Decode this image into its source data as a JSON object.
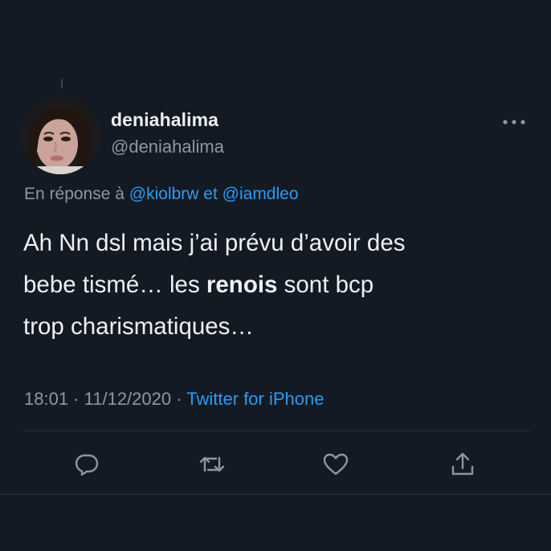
{
  "tweet": {
    "author": {
      "display_name": "deniahalima",
      "handle": "@deniahalima"
    },
    "reply_prefix": "En réponse à",
    "reply_mentions": [
      "@kiolbrw",
      "@iamdleo"
    ],
    "reply_joiner": "et",
    "text_parts": {
      "line1": "Ah Nn dsl mais j’ai prévu d’avoir des",
      "line2_before": "bebe tismé… les ",
      "line2_bold": "renois",
      "line2_after": " sont bcp",
      "line3": "trop charismatiques…"
    },
    "time": "18:01",
    "date": "11/12/2020",
    "separator": "·",
    "source": "Twitter for iPhone"
  },
  "actions": [
    "reply-icon",
    "retweet-icon",
    "like-icon",
    "share-icon"
  ],
  "colors": {
    "background": "#141a24",
    "text": "#eef1f4",
    "muted": "#8b97a4",
    "link": "#2c9bf0",
    "divider": "#2b3340"
  }
}
